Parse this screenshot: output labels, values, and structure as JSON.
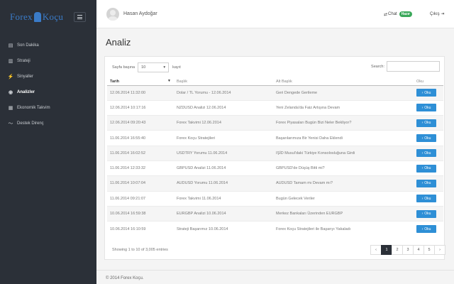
{
  "brand": {
    "pre": "Forex",
    "post": "Koçu"
  },
  "sidebar": {
    "items": [
      {
        "label": "Son Dakika",
        "icon": "newspaper-icon",
        "glyph": "▤"
      },
      {
        "label": "Strateji",
        "icon": "book-icon",
        "glyph": "▥"
      },
      {
        "label": "Sinyaller",
        "icon": "signal-icon",
        "glyph": "⚡"
      },
      {
        "label": "Analizler",
        "icon": "eye-icon",
        "glyph": "◉"
      },
      {
        "label": "Ekonomik Takvim",
        "icon": "calendar-icon",
        "glyph": "▦"
      },
      {
        "label": "Destek Direnç",
        "icon": "trend-icon",
        "glyph": "〜"
      }
    ],
    "active_index": 3
  },
  "header": {
    "username": "Hasan Aydoğar",
    "chat_label": "Chat",
    "chat_status": "Hazır",
    "logout_label": "Çıkış",
    "status_color": "#3aa85a"
  },
  "page": {
    "title": "Analiz"
  },
  "table_controls": {
    "length_prefix": "Sayfa başına",
    "length_value": "10",
    "length_suffix": "kayıt",
    "search_label": "Search:",
    "search_value": ""
  },
  "table": {
    "columns": [
      "Tarih",
      "Başlık",
      "Alt Başlık",
      "Oku"
    ],
    "button_label": "Oku",
    "rows": [
      {
        "date": "12.06.2014 11:32:00",
        "title": "Dolar / TL Yorumu - 12.06.2014",
        "subtitle": "Geri Dengede Gerileme"
      },
      {
        "date": "12.06.2014 10:17:16",
        "title": "NZDUSD Analizi 12.06.2014",
        "subtitle": "Yeni Zelanda'da Faiz Artışına Devam"
      },
      {
        "date": "12.06.2014 09:20:43",
        "title": "Forex Takvimi 12.06.2014",
        "subtitle": "Forex Piyasaları Bugün Bizi Neler Bekliyor?"
      },
      {
        "date": "11.06.2014 16:55:40",
        "title": "Forex Koçu Stratejileri",
        "subtitle": "Başarılarımıza Bir Yenisi Daha Eklendi"
      },
      {
        "date": "11.06.2014 16:02:52",
        "title": "USDTRY Yorumu 11.06.2014",
        "subtitle": "IŞİD Musul'daki Türkiye Konsolosluğuna Girdi"
      },
      {
        "date": "11.06.2014 12:33:32",
        "title": "GBPUSD Analizi 11.06.2014",
        "subtitle": "GBPUSD'de Düşüş Bitti mi?"
      },
      {
        "date": "11.06.2014 10:07:04",
        "title": "AUDUSD Yorumu 11.06.2014",
        "subtitle": "AUDUSD Tamam mı Devam mı?"
      },
      {
        "date": "11.06.2014 09:21:07",
        "title": "Forex Takvimi 11.06.2014",
        "subtitle": "Bugün Gelecek Veriler"
      },
      {
        "date": "10.06.2014 16:59:38",
        "title": "EURGBP Analizi 10.06.2014",
        "subtitle": "Merkez Bankaları Üzerinden EURGBP"
      },
      {
        "date": "10.06.2014 16:10:59",
        "title": "Strateji Başarımız 10.06.2014",
        "subtitle": "Forex Koçu Stratejileri ile Başarıyı Yakaladı"
      }
    ],
    "button_color": "#2e8fd6"
  },
  "info": "Showing 1 to 10 of 3,005 entries",
  "pagination": [
    "‹",
    "1",
    "2",
    "3",
    "4",
    "5",
    "›"
  ],
  "pagination_current": "1",
  "footer": "© 2014 Forex Koçu."
}
